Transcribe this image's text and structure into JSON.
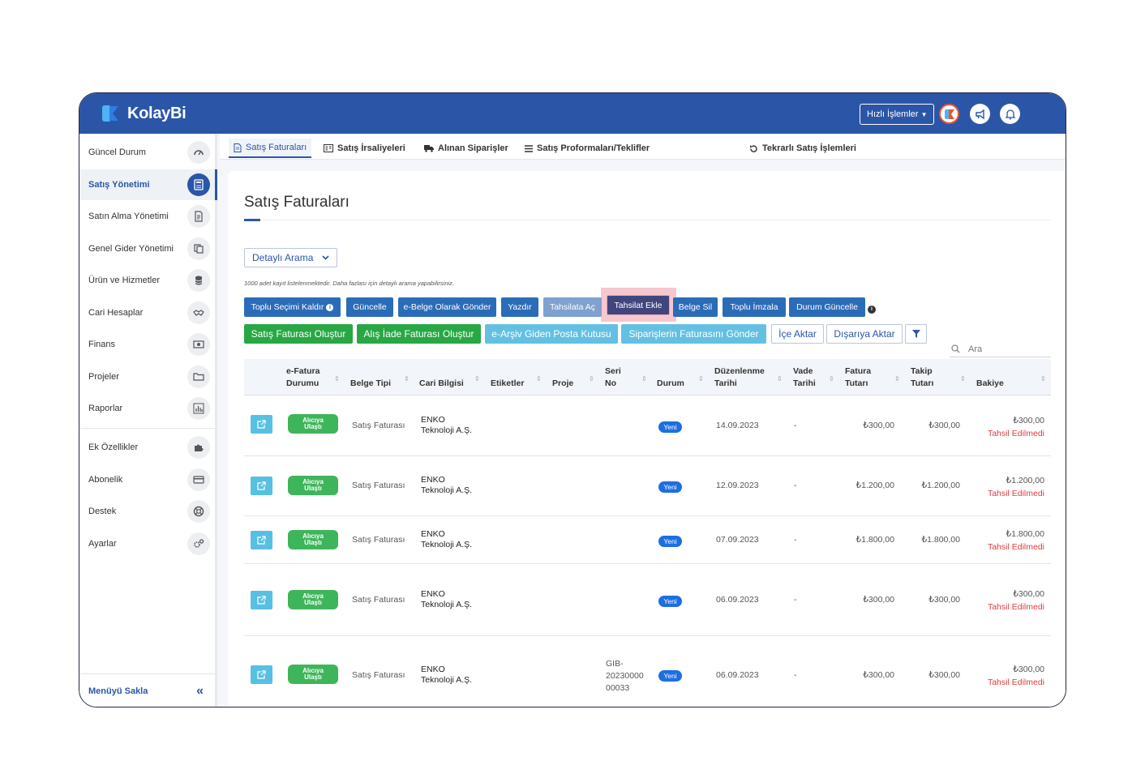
{
  "app": {
    "logo_text": "KolayBi"
  },
  "topbar": {
    "quick_actions_label": "Hızlı İşlemler"
  },
  "sidebar": {
    "items": [
      {
        "label": "Güncel Durum"
      },
      {
        "label": "Satış Yönetimi"
      },
      {
        "label": "Satın Alma Yönetimi"
      },
      {
        "label": "Genel Gider Yönetimi"
      },
      {
        "label": "Ürün ve Hizmetler"
      },
      {
        "label": "Cari Hesaplar"
      },
      {
        "label": "Finans"
      },
      {
        "label": "Projeler"
      },
      {
        "label": "Raporlar"
      },
      {
        "label": "Ek Özellikler"
      },
      {
        "label": "Abonelik"
      },
      {
        "label": "Destek"
      },
      {
        "label": "Ayarlar"
      }
    ],
    "footer_label": "Menüyü Sakla"
  },
  "tabs": [
    {
      "label": "Satış Faturaları"
    },
    {
      "label": "Satış İrsaliyeleri"
    },
    {
      "label": "Alınan Siparişler"
    },
    {
      "label": "Satış Proformaları/Teklifler"
    },
    {
      "label": "Tekrarlı Satış İşlemleri"
    }
  ],
  "page": {
    "title": "Satış Faturaları",
    "detail_search_label": "Detaylı Arama",
    "note": "1000 adet kayıt listelenmektedir. Daha fazlası için detaylı arama yapabilirsiniz."
  },
  "actions_row1": {
    "toplu_secimi_kaldir": "Toplu Seçimi Kaldır",
    "guncelle": "Güncelle",
    "ebelge_gonder": "e-Belge Olarak Gönder",
    "yazdir": "Yazdır",
    "tahsilata_ac": "Tahsilata Aç",
    "tahsilat_ekle": "Tahsilat Ekle",
    "belge_sil": "Belge Sil",
    "toplu_imzala": "Toplu İmzala",
    "durum_guncelle": "Durum Güncelle"
  },
  "actions_row2": {
    "satis_faturasi_olustur": "Satış Faturası Oluştur",
    "alis_iade_olustur": "Alış İade Faturası Oluştur",
    "earsiv_posta": "e-Arşiv Giden Posta Kutusu",
    "siparis_fatura_gonder": "Siparişlerin Faturasını Gönder",
    "ice_aktar": "İçe Aktar",
    "disariya_aktar": "Dışarıya Aktar"
  },
  "search": {
    "placeholder": "Ara"
  },
  "table": {
    "headers": {
      "efatura_1": "e-Fatura",
      "efatura_2": "Durumu",
      "belge_tipi": "Belge Tipi",
      "cari_bilgisi": "Cari Bilgisi",
      "etiketler": "Etiketler",
      "proje": "Proje",
      "seri_1": "Seri",
      "seri_2": "No",
      "durum": "Durum",
      "duzenlenme_1": "Düzenlenme",
      "duzenlenme_2": "Tarihi",
      "vade_1": "Vade",
      "vade_2": "Tarihi",
      "fatura_1": "Fatura",
      "fatura_2": "Tutarı",
      "takip_1": "Takip",
      "takip_2": "Tutarı",
      "bakiye": "Bakiye"
    },
    "rows": [
      {
        "status_1": "Alıcıya",
        "status_2": "Ulaştı",
        "belge_tipi": "Satış Faturası",
        "cari_1": "ENKO",
        "cari_2": "Teknoloji A.Ş.",
        "seri_1": "",
        "seri_2": "",
        "seri_3": "",
        "durum": "Yeni",
        "tarih": "14.09.2023",
        "vade": "-",
        "fatura": "₺300,00",
        "takip": "₺300,00",
        "bakiye": "₺300,00",
        "bakiye_status": "Tahsil Edilmedi"
      },
      {
        "status_1": "Alıcıya",
        "status_2": "Ulaştı",
        "belge_tipi": "Satış Faturası",
        "cari_1": "ENKO",
        "cari_2": "Teknoloji A.Ş.",
        "seri_1": "",
        "seri_2": "",
        "seri_3": "",
        "durum": "Yeni",
        "tarih": "12.09.2023",
        "vade": "-",
        "fatura": "₺1.200,00",
        "takip": "₺1.200,00",
        "bakiye": "₺1.200,00",
        "bakiye_status": "Tahsil Edilmedi"
      },
      {
        "status_1": "Alıcıya",
        "status_2": "Ulaştı",
        "belge_tipi": "Satış Faturası",
        "cari_1": "ENKO",
        "cari_2": "Teknoloji A.Ş.",
        "seri_1": "",
        "seri_2": "",
        "seri_3": "",
        "durum": "Yeni",
        "tarih": "07.09.2023",
        "vade": "-",
        "fatura": "₺1.800,00",
        "takip": "₺1.800,00",
        "bakiye": "₺1.800,00",
        "bakiye_status": "Tahsil Edilmedi"
      },
      {
        "status_1": "Alıcıya",
        "status_2": "Ulaştı",
        "belge_tipi": "Satış Faturası",
        "cari_1": "ENKO",
        "cari_2": "Teknoloji A.Ş.",
        "seri_1": "",
        "seri_2": "",
        "seri_3": "",
        "durum": "Yeni",
        "tarih": "06.09.2023",
        "vade": "-",
        "fatura": "₺300,00",
        "takip": "₺300,00",
        "bakiye": "₺300,00",
        "bakiye_status": "Tahsil Edilmedi"
      },
      {
        "status_1": "Alıcıya",
        "status_2": "Ulaştı",
        "belge_tipi": "Satış Faturası",
        "cari_1": "ENKO",
        "cari_2": "Teknoloji A.Ş.",
        "seri_1": "GIB-",
        "seri_2": "20230000",
        "seri_3": "00033",
        "durum": "Yeni",
        "tarih": "06.09.2023",
        "vade": "-",
        "fatura": "₺300,00",
        "takip": "₺300,00",
        "bakiye": "₺300,00",
        "bakiye_status": "Tahsil Edilmedi"
      }
    ]
  },
  "colors": {
    "brand": "#2b56a8",
    "success": "#28a745",
    "info": "#63c0e3",
    "danger": "#e23c3c"
  }
}
